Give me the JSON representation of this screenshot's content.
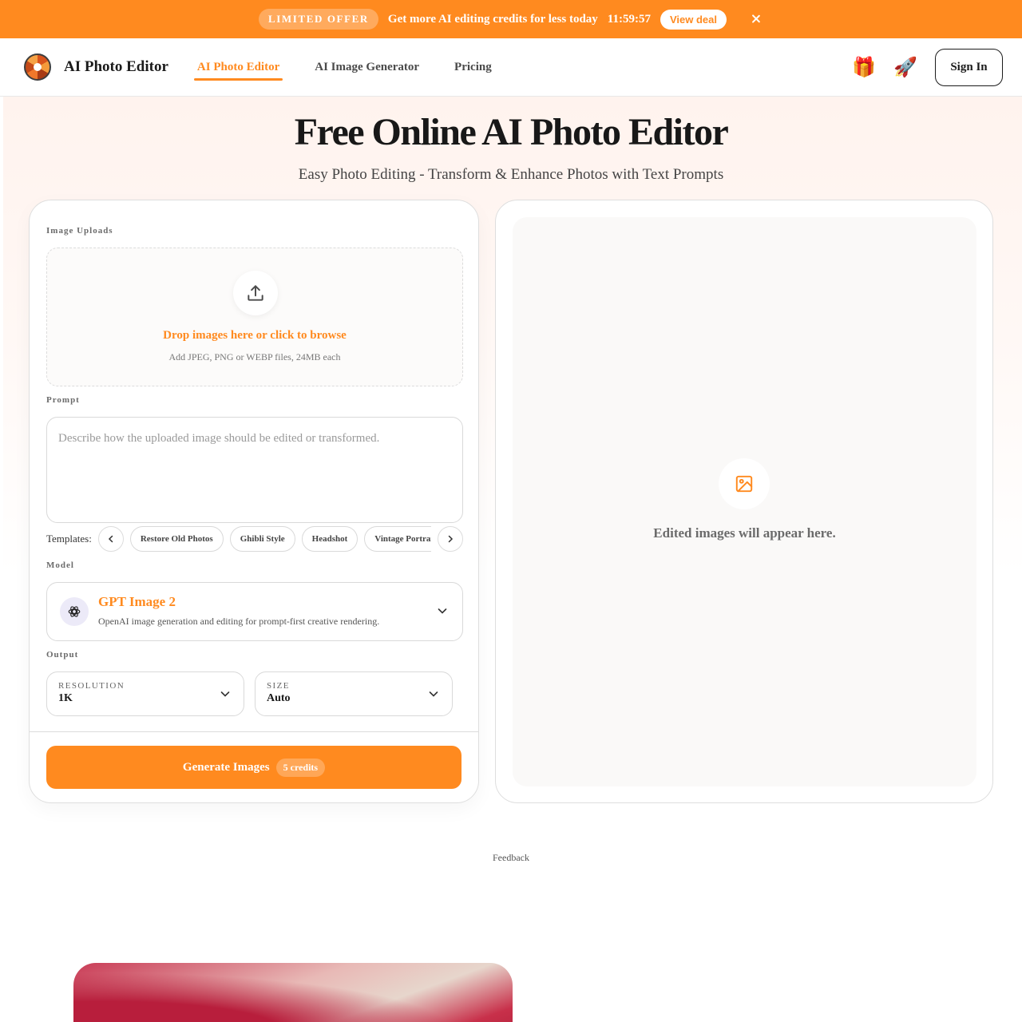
{
  "promo": {
    "badge": "LIMITED OFFER",
    "text": "Get more AI editing credits for less today",
    "timer": "11:59:57",
    "cta": "View deal"
  },
  "header": {
    "brand": "AI Photo Editor",
    "nav": [
      {
        "label": "AI Photo Editor",
        "active": true
      },
      {
        "label": "AI Image Generator",
        "active": false
      },
      {
        "label": "Pricing",
        "active": false
      }
    ],
    "gift_icon": "🎁",
    "rocket_icon": "🚀",
    "sign_in": "Sign In"
  },
  "hero": {
    "title": "Free Online AI Photo Editor",
    "subtitle": "Easy Photo Editing - Transform & Enhance Photos with Text Prompts"
  },
  "editor": {
    "uploads_label": "Image Uploads",
    "drop_title": "Drop images here or click to browse",
    "drop_sub": "Add JPEG, PNG or WEBP files, 24MB each",
    "prompt_label": "Prompt",
    "prompt_placeholder": "Describe how the uploaded image should be edited or transformed.",
    "prompt_value": "",
    "templates_label": "Templates:",
    "templates": [
      "Restore Old Photos",
      "Ghibli Style",
      "Headshot",
      "Vintage Portrait"
    ],
    "model_label": "Model",
    "model_name": "GPT Image 2",
    "model_desc": "OpenAI image generation and editing for prompt-first creative rendering.",
    "output_label": "Output",
    "resolution_label": "RESOLUTION",
    "resolution_value": "1K",
    "size_label": "SIZE",
    "size_value": "Auto",
    "generate_label": "Generate Images",
    "credits": "5 credits"
  },
  "result": {
    "placeholder": "Edited images will appear here."
  },
  "footer": {
    "feedback": "Feedback"
  },
  "colors": {
    "accent": "#ff8a1f",
    "text": "#1c1c1c"
  },
  "icons": {
    "upload": "upload-icon",
    "image": "image-icon",
    "model": "openai-icon",
    "chevron": "chevron-down-icon"
  }
}
